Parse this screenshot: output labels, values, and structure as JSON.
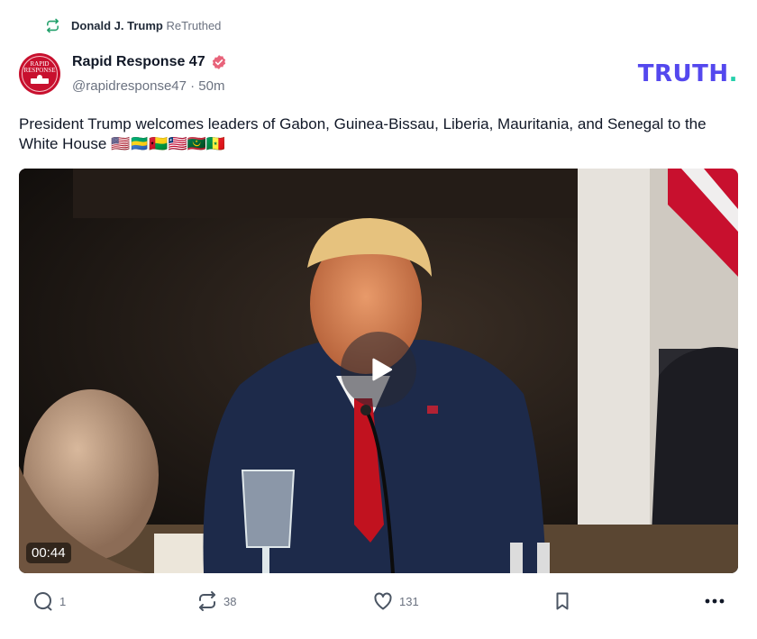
{
  "retruth": {
    "user": "Donald J. Trump",
    "label": "ReTruthed"
  },
  "author": {
    "name": "Rapid Response 47",
    "handle_time": "@rapidresponse47 · 50m",
    "avatar_text": "RAPID RESPONSE"
  },
  "brand": {
    "name": "TRUTH",
    "dot": "."
  },
  "post": {
    "text": "President Trump welcomes leaders of Gabon, Guinea-Bissau, Liberia, Mauritania, and Senegal to the White House 🇺🇸🇬🇦🇬🇼🇱🇷🇲🇷🇸🇳"
  },
  "video": {
    "duration": "00:44"
  },
  "actions": {
    "replies": "1",
    "retruths": "38",
    "likes": "131"
  },
  "colors": {
    "brand": "#5448ee",
    "brand_dot": "#25d0ab",
    "avatar_bg": "#c8102e",
    "verified": "#e8637a"
  },
  "icons": [
    "retruth-icon",
    "verified-icon",
    "play-icon",
    "reply-icon",
    "like-icon",
    "bookmark-icon",
    "more-icon"
  ]
}
